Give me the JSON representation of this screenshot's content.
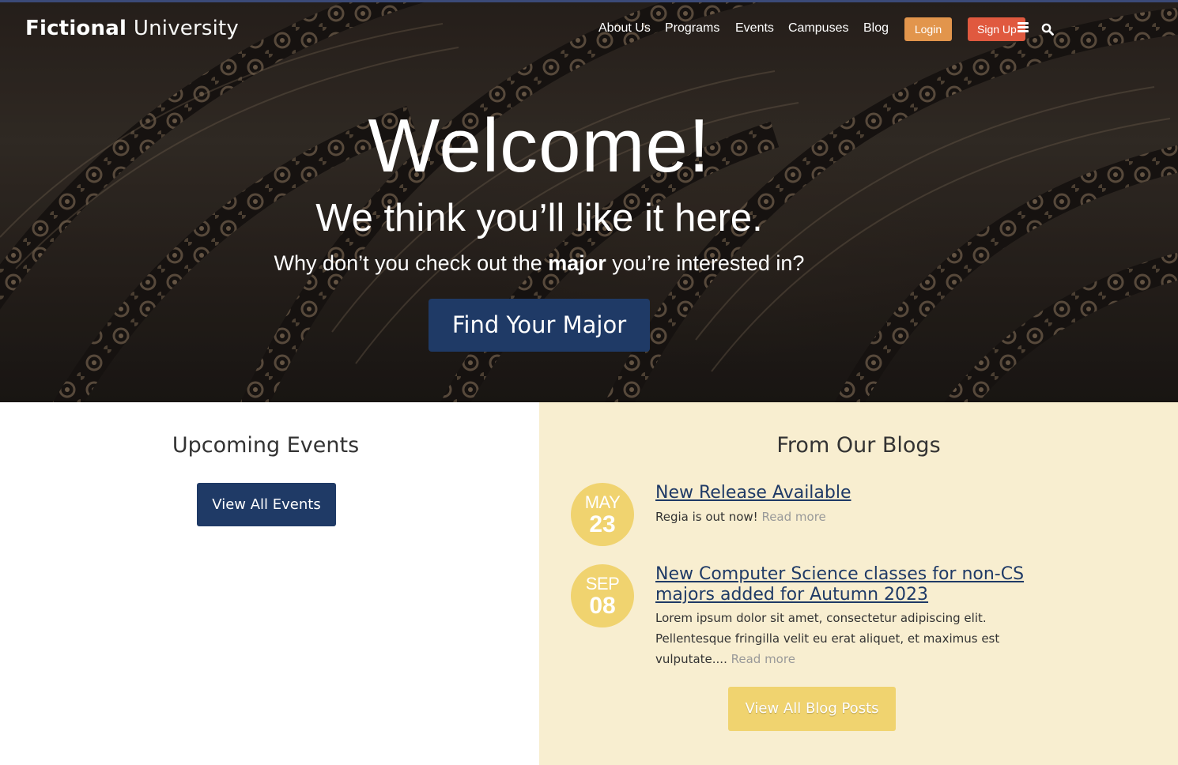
{
  "header": {
    "logo_bold": "Fictional",
    "logo_light": "University",
    "nav": [
      "About Us",
      "Programs",
      "Events",
      "Campuses",
      "Blog"
    ],
    "login_label": "Login",
    "signup_label": "Sign Up"
  },
  "hero": {
    "title": "Welcome!",
    "subtitle": "We think you’ll like it here.",
    "question_before": "Why don’t you check out the ",
    "question_bold": "major",
    "question_after": " you’re interested in?",
    "button_label": "Find Your Major"
  },
  "events": {
    "title": "Upcoming Events",
    "button_label": "View All Events"
  },
  "blogs": {
    "title": "From Our Blogs",
    "posts": [
      {
        "month": "MAY",
        "day": "23",
        "title": "New Release Available",
        "excerpt": "Regia is out now! ",
        "read_more": "Read more"
      },
      {
        "month": "SEP",
        "day": "08",
        "title": "New Computer Science classes for non-CS majors added for Autumn 2023",
        "excerpt": "Lorem ipsum dolor sit amet, consectetur adipiscing elit. Pellentesque fringilla velit eu erat aliquet, et maximus est vulputate.... ",
        "read_more": "Read more"
      }
    ],
    "button_label": "View All Blog Posts"
  },
  "colors": {
    "navy": "#1f3a66",
    "login_orange": "#e2954c",
    "signup_red": "#e0593f",
    "gold": "#f0d36f",
    "cream": "#f8eed0"
  }
}
